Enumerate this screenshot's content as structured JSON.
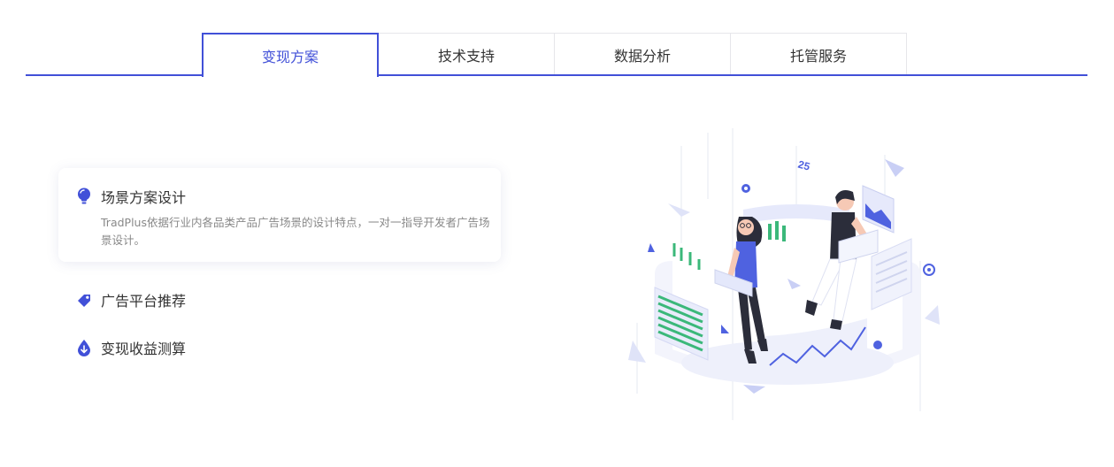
{
  "tabs": [
    {
      "label": "变现方案",
      "active": true
    },
    {
      "label": "技术支持",
      "active": false
    },
    {
      "label": "数据分析",
      "active": false
    },
    {
      "label": "托管服务",
      "active": false
    }
  ],
  "features": {
    "card": {
      "icon": "lightbulb-icon",
      "title": "场景方案设计",
      "desc": "TradPlus依据行业内各品类产品广告场景的设计特点，一对一指导开发者广告场景设计。"
    },
    "items": [
      {
        "icon": "tag-icon",
        "title": "广告平台推荐"
      },
      {
        "icon": "drop-download-icon",
        "title": "变现收益测算"
      }
    ]
  },
  "illustration": {
    "badge_text": "25"
  },
  "colors": {
    "accent": "#4150d8",
    "green": "#3bb87a",
    "light_panel": "#e9ecfb"
  }
}
